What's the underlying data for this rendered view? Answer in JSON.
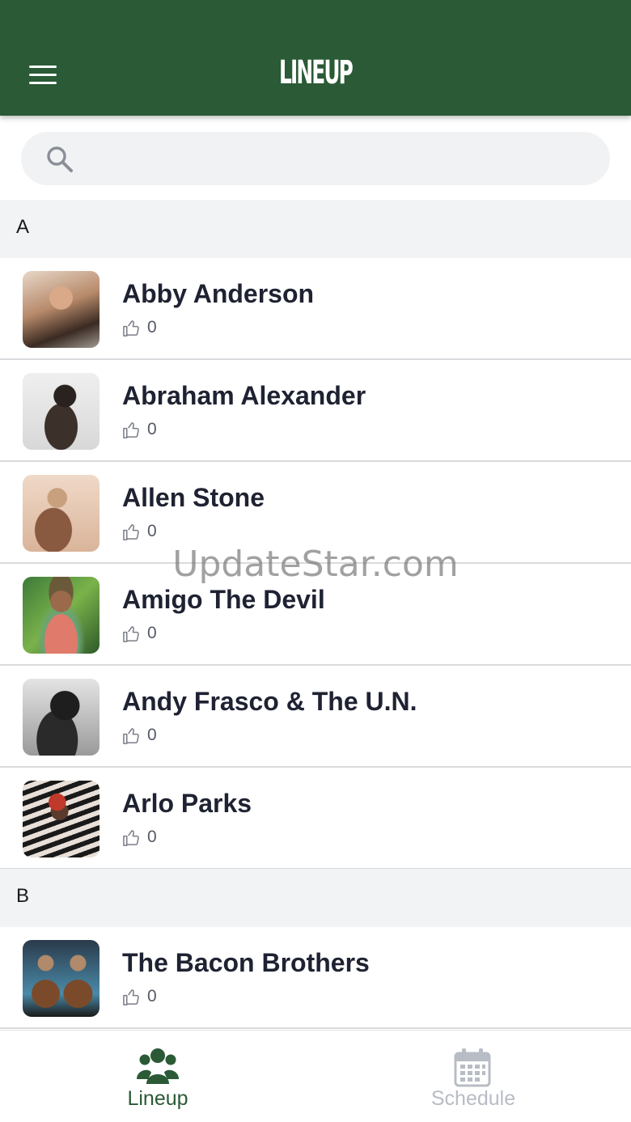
{
  "header": {
    "title": "LINEUP",
    "color": "#2a5a36"
  },
  "search": {
    "placeholder": "",
    "value": ""
  },
  "sections": [
    {
      "letter": "A",
      "artists": [
        {
          "name": "Abby Anderson",
          "likes": "0"
        },
        {
          "name": "Abraham Alexander",
          "likes": "0"
        },
        {
          "name": "Allen Stone",
          "likes": "0"
        },
        {
          "name": "Amigo The Devil",
          "likes": "0"
        },
        {
          "name": "Andy Frasco & The U.N.",
          "likes": "0"
        },
        {
          "name": "Arlo Parks",
          "likes": "0"
        }
      ]
    },
    {
      "letter": "B",
      "artists": [
        {
          "name": "The Bacon Brothers",
          "likes": "0"
        }
      ]
    }
  ],
  "watermark": "UpdateStar.com",
  "bottom_nav": {
    "tabs": [
      {
        "label": "Lineup",
        "icon": "users-icon",
        "active": true
      },
      {
        "label": "Schedule",
        "icon": "calendar-icon",
        "active": false
      }
    ],
    "active_color": "#2a5a36",
    "inactive_color": "#b8bcc4"
  }
}
